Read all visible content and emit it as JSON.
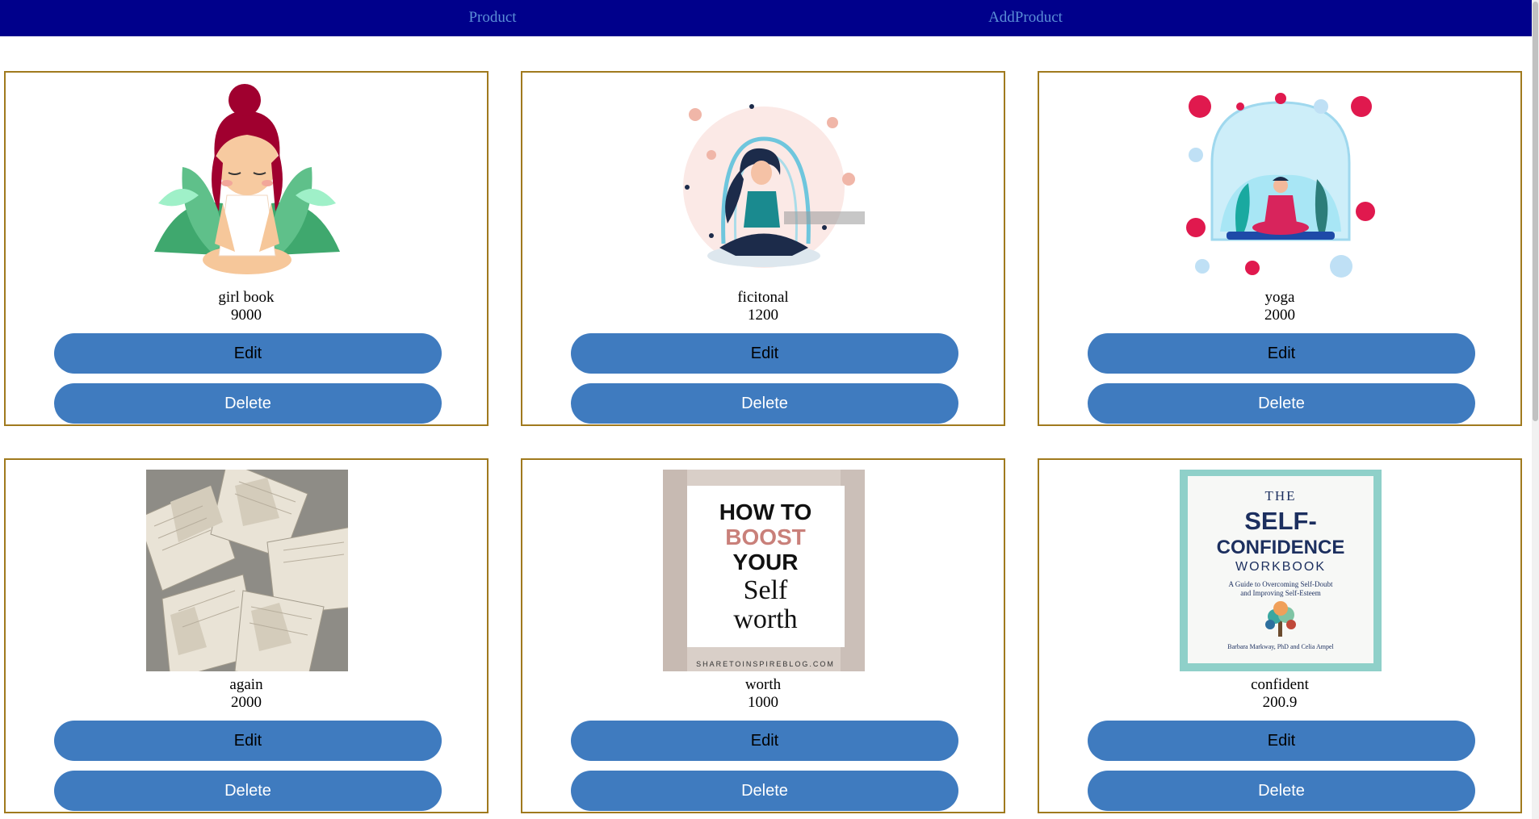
{
  "nav": {
    "product_label": "Product",
    "add_product_label": "AddProduct"
  },
  "colors": {
    "navbar": "#00008b",
    "nav_link": "#5b8fd6",
    "card_border": "#a07a1e",
    "button": "#3f7bbf"
  },
  "buttons": {
    "edit_label": "Edit",
    "delete_label": "Delete"
  },
  "products": [
    {
      "name": "girl book",
      "price": "9000",
      "image": "meditating-girl-with-leaves"
    },
    {
      "name": "ficitonal",
      "price": "1200",
      "image": "meditating-woman-with-dots"
    },
    {
      "name": "yoga",
      "price": "2000",
      "image": "yoga-dome-with-viruses"
    },
    {
      "name": "again",
      "price": "2000",
      "image": "open-books-pile"
    },
    {
      "name": "worth",
      "price": "1000",
      "image": "how-to-boost-your-self-worth-cover"
    },
    {
      "name": "confident",
      "price": "200.9",
      "image": "self-confidence-workbook-cover"
    }
  ],
  "covers": {
    "worth": {
      "line1": "HOW TO",
      "line2": "BOOST",
      "line3": "YOUR",
      "line4": "Self",
      "line5": "worth",
      "footer": "SHARETOINSPIREBLOG.COM"
    },
    "confident": {
      "line1": "THE",
      "line2": "SELF-",
      "line3": "CONFIDENCE",
      "line4": "WORKBOOK",
      "subtitle1": "A Guide to Overcoming Self-Doubt",
      "subtitle2": "and Improving Self-Esteem",
      "authors": "Barbara Markway, PhD and Celia Ampel"
    }
  }
}
